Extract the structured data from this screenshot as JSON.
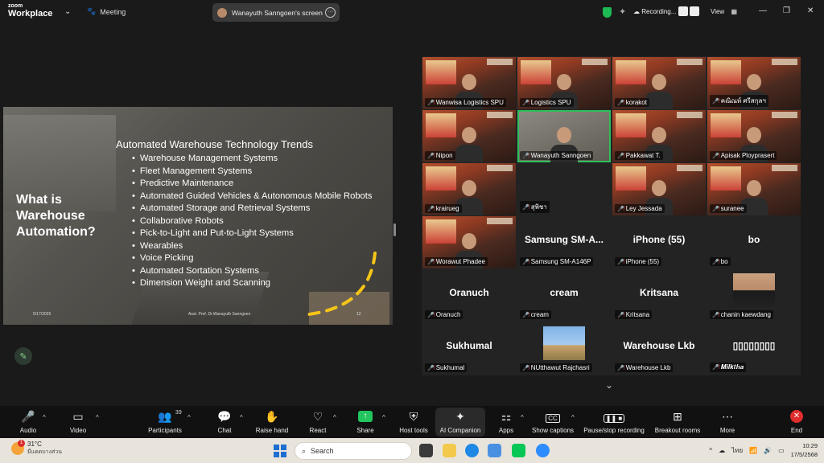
{
  "app": {
    "brand_line1": "zoom",
    "brand_line2": "Workplace",
    "meeting_label": "Meeting"
  },
  "share": {
    "label": "Wanayuth Sanngoen's screen"
  },
  "status": {
    "recording_label": "Recording...",
    "view_label": "View"
  },
  "slide": {
    "title": "What is Warehouse Automation?",
    "heading": "Automated Warehouse Technology Trends",
    "items": [
      "Warehouse Management Systems",
      "Fleet Management Systems",
      "Predictive Maintenance",
      "Automated Guided Vehicles & Autonomous Mobile Robots",
      "Automated Storage and Retrieval Systems",
      "Collaborative Robots",
      "Pick-to-Light and Put-to-Light Systems",
      "Wearables",
      "Voice Picking",
      "Automated Sortation Systems",
      "Dimension Weight and Scanning"
    ],
    "footer_date": "5/17/2025",
    "footer_author": "Asst. Prof. Dr.Wanayuth Sanngoen",
    "footer_page": "12"
  },
  "gallery": {
    "tiles": [
      {
        "name": "Wanwisa Logistics SPU",
        "big": "",
        "kind": "video"
      },
      {
        "name": "Logistics SPU",
        "big": "",
        "kind": "video"
      },
      {
        "name": "korakot",
        "big": "",
        "kind": "video"
      },
      {
        "name": "คณิณท์ ศรีสกุลฯ",
        "big": "",
        "kind": "video"
      },
      {
        "name": "Nipon",
        "big": "",
        "kind": "video"
      },
      {
        "name": "Wanayuth Sanngoen",
        "big": "",
        "kind": "cam"
      },
      {
        "name": "Pakkawat T.",
        "big": "",
        "kind": "video"
      },
      {
        "name": "Apisak Ployprasert",
        "big": "",
        "kind": "video"
      },
      {
        "name": "krairueg",
        "big": "",
        "kind": "video"
      },
      {
        "name": "สุพิชา",
        "big": "",
        "kind": "blank"
      },
      {
        "name": "Ley Jessada",
        "big": "",
        "kind": "video"
      },
      {
        "name": "suranee",
        "big": "",
        "kind": "video"
      },
      {
        "name": "Worawut Phadee",
        "big": "",
        "kind": "video"
      },
      {
        "name": "Samsung SM-A146P",
        "big": "Samsung  SM-A...",
        "kind": "text"
      },
      {
        "name": "iPhone (55)",
        "big": "iPhone (55)",
        "kind": "text"
      },
      {
        "name": "bo",
        "big": "bo",
        "kind": "text"
      },
      {
        "name": "Oranuch",
        "big": "Oranuch",
        "kind": "text"
      },
      {
        "name": "cream",
        "big": "cream",
        "kind": "text"
      },
      {
        "name": "Kritsana",
        "big": "Kritsana",
        "kind": "text"
      },
      {
        "name": "chanin kaewdang",
        "big": "",
        "kind": "photo"
      },
      {
        "name": "Sukhumal",
        "big": "Sukhumal",
        "kind": "text"
      },
      {
        "name": "NUtthawut Rajchasri",
        "big": "",
        "kind": "photo2"
      },
      {
        "name": "Warehouse Lkb",
        "big": "Warehouse Lkb",
        "kind": "text"
      },
      {
        "name": "𝑴𝒊𝒍𝒌𝒕𝒉𝒂",
        "big": "▯▯▯▯▯▯▯▯",
        "kind": "text"
      }
    ]
  },
  "toolbar": {
    "audio": "Audio",
    "video": "Video",
    "participants": "Participants",
    "participants_count": "39",
    "chat": "Chat",
    "raise_hand": "Raise hand",
    "react": "React",
    "share": "Share",
    "host_tools": "Host tools",
    "ai_companion": "AI Companion",
    "apps": "Apps",
    "show_captions": "Show captions",
    "pause_recording": "Pause/stop recording",
    "breakout_rooms": "Breakout rooms",
    "more": "More",
    "end": "End"
  },
  "taskbar": {
    "temperature": "31°C",
    "weather_text": "มีแดดบางส่วน",
    "alert_count": "1",
    "search_placeholder": "Search",
    "language": "ไทย",
    "time": "10:29",
    "date": "17/5/2568"
  }
}
